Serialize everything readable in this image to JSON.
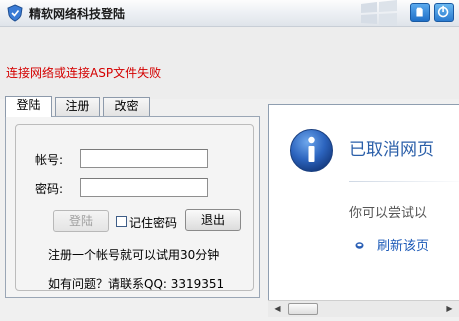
{
  "window": {
    "title": "精软网络科技登陆",
    "error_message": "连接网络或连接ASP文件失败"
  },
  "tabs": [
    {
      "label": "登陆",
      "active": true
    },
    {
      "label": "注册",
      "active": false
    },
    {
      "label": "改密",
      "active": false
    }
  ],
  "login": {
    "account_label": "帐号:",
    "password_label": "密码:",
    "account_value": "",
    "password_value": "",
    "login_button": "登陆",
    "remember_label": "记住密码",
    "remember_checked": false,
    "exit_button": "退出",
    "trial_note": "注册一个帐号就可以试用30分钟",
    "contact_note": "如有问题？请联系QQ: 3319351"
  },
  "browser": {
    "heading": "已取消网页",
    "suggestion": "你可以尝试以",
    "refresh_link": "刷新该页"
  },
  "colors": {
    "error": "#d40000",
    "accent": "#2b5fa9",
    "link": "#1e5bb8"
  },
  "icons": [
    "app-shield-icon",
    "skin-icon",
    "close-icon",
    "info-icon",
    "bullet-icon"
  ]
}
